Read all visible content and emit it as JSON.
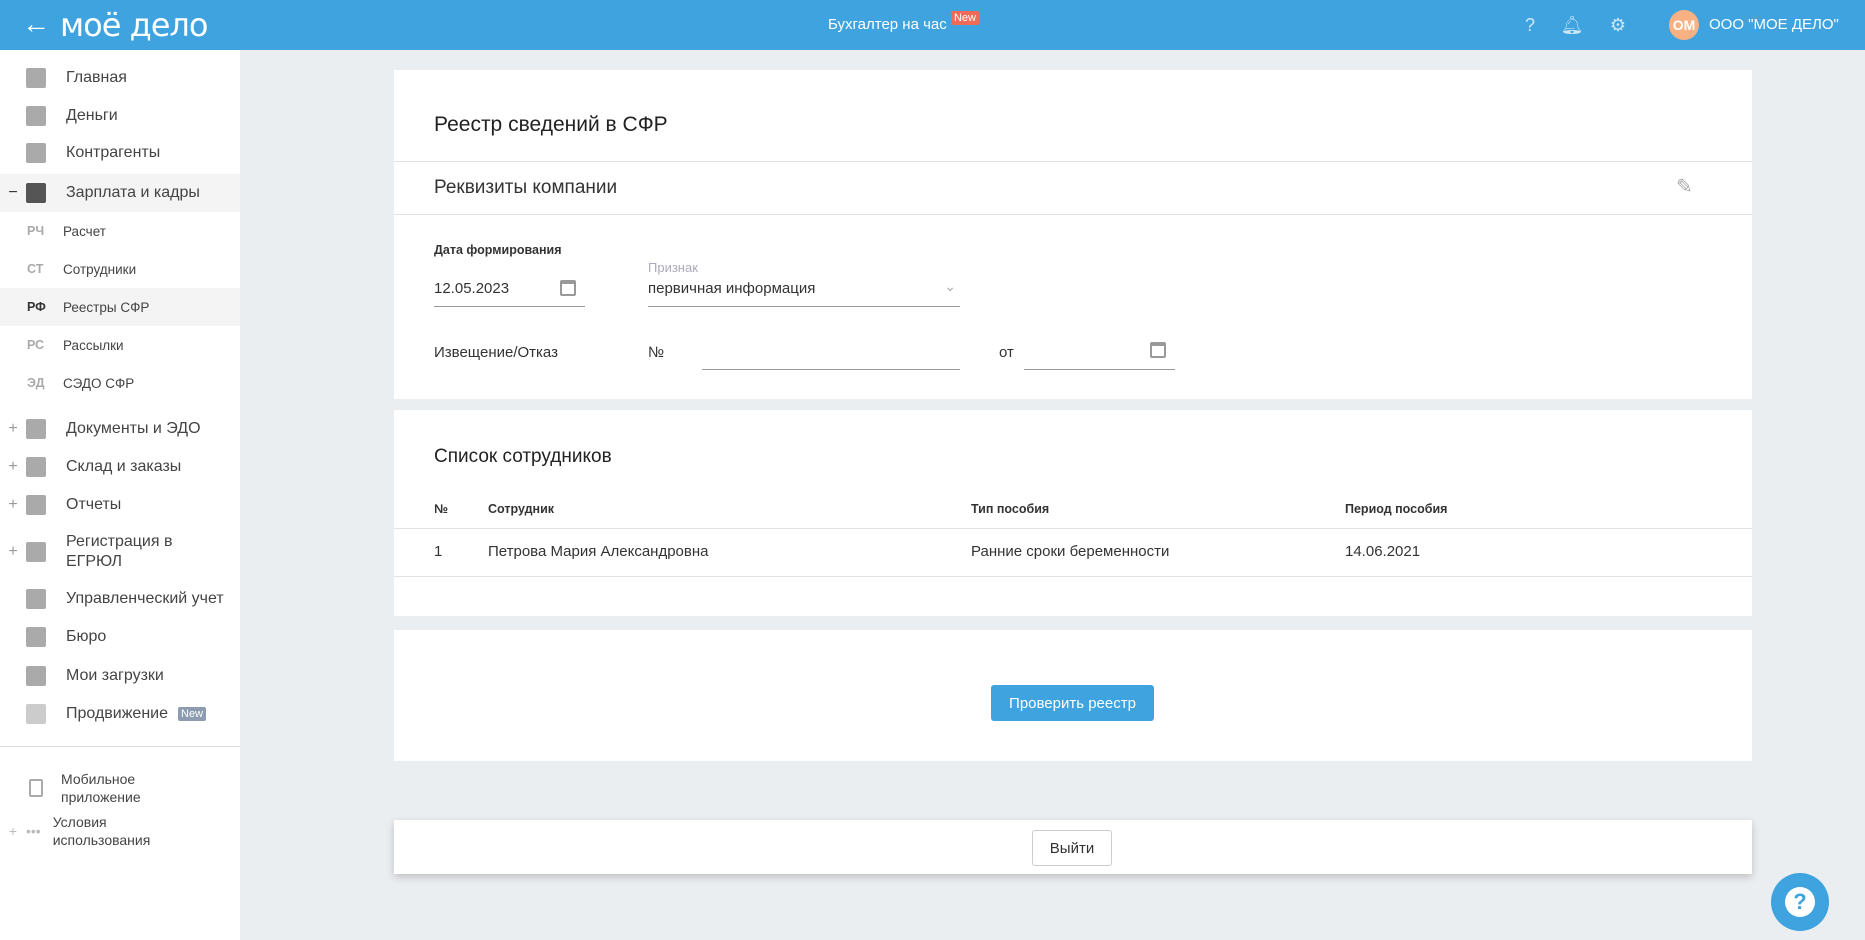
{
  "header": {
    "back_icon": "arrow-left-icon",
    "logo": "моё дело",
    "center_link": "Бухгалтер на час",
    "center_badge": "New",
    "avatar_initials": "ОМ",
    "org_name": "ООО \"МОЕ ДЕЛО\""
  },
  "sidebar": {
    "items": [
      {
        "label": "Главная",
        "icon": "home-icon",
        "toggle": ""
      },
      {
        "label": "Деньги",
        "icon": "money-icon",
        "toggle": ""
      },
      {
        "label": "Контрагенты",
        "icon": "contractor-icon",
        "toggle": ""
      },
      {
        "label": "Зарплата и кадры",
        "icon": "wallet-icon",
        "toggle": "−"
      }
    ],
    "subitems": [
      {
        "abbr": "РЧ",
        "label": "Расчет"
      },
      {
        "abbr": "СТ",
        "label": "Сотрудники"
      },
      {
        "abbr": "РФ",
        "label": "Реестры СФР"
      },
      {
        "abbr": "РС",
        "label": "Рассылки"
      },
      {
        "abbr": "ЭД",
        "label": "СЭДО СФР"
      }
    ],
    "items2": [
      {
        "label": "Документы и ЭДО",
        "toggle": "+"
      },
      {
        "label": "Склад и заказы",
        "toggle": "+"
      },
      {
        "label": "Отчеты",
        "toggle": "+"
      },
      {
        "label": "Регистрация в ЕГРЮЛ",
        "toggle": "+"
      },
      {
        "label": "Управленческий учет",
        "toggle": ""
      },
      {
        "label": "Бюро",
        "toggle": ""
      },
      {
        "label": "Мои загрузки",
        "toggle": ""
      },
      {
        "label": "Продвижение",
        "toggle": "",
        "badge": "New"
      }
    ],
    "footer": [
      {
        "label": "Мобильное приложение"
      },
      {
        "label": "Условия использования",
        "toggle": "+"
      }
    ]
  },
  "page": {
    "title": "Реестр сведений в СФР",
    "section": "Реквизиты компании",
    "date_label": "Дата формирования",
    "date_value": "12.05.2023",
    "sign_label": "Признак",
    "sign_value": "первичная информация",
    "notice_label": "Извещение/Отказ",
    "number_label": "№",
    "number_value": "",
    "from_label": "от",
    "from_value": ""
  },
  "employees": {
    "title": "Список сотрудников",
    "columns": [
      "№",
      "Сотрудник",
      "Тип пособия",
      "Период пособия"
    ],
    "rows": [
      [
        "1",
        "Петрова Мария Александровна",
        "Ранние сроки беременности",
        "14.06.2021"
      ]
    ]
  },
  "actions": {
    "check": "Проверить реестр",
    "exit": "Выйти",
    "help": "?"
  }
}
